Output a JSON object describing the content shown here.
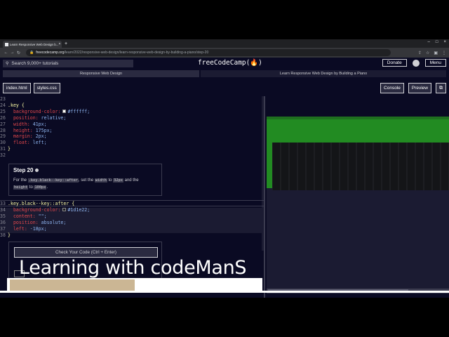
{
  "browser": {
    "tab_title": "Learn Responsive Web Design b...",
    "new_tab": "+",
    "url_host": "freecodecamp.org",
    "url_path": "/learn/2022/responsive-web-design/learn-responsive-web-design-by-building-a-piano/step-20"
  },
  "nav": {
    "search_placeholder": "Search 9,000+ tutorials",
    "brand": "freeCodeCamp(🔥)",
    "donate": "Donate",
    "menu": "Menu"
  },
  "breadcrumb": {
    "course": "Responsive Web Design",
    "project": "Learn Responsive Web Design by Building a Piano"
  },
  "editor": {
    "tabs": [
      "index.html",
      "styles.css"
    ],
    "console": "Console",
    "preview": "Preview"
  },
  "code_top": [
    {
      "n": "23"
    },
    {
      "n": "24",
      "sel": ".key {"
    },
    {
      "n": "25",
      "prop": "  background-color:",
      "swatch": "#ffffff",
      "val": "#ffffff;"
    },
    {
      "n": "26",
      "prop": "  position:",
      "val": " relative;"
    },
    {
      "n": "27",
      "prop": "  width:",
      "val": " 41px;"
    },
    {
      "n": "28",
      "prop": "  height:",
      "val": " 175px;"
    },
    {
      "n": "29",
      "prop": "  margin:",
      "val": " 2px;"
    },
    {
      "n": "30",
      "prop": "  float:",
      "val": " left;"
    },
    {
      "n": "31",
      "sel": "}"
    },
    {
      "n": "32"
    }
  ],
  "step": {
    "title": "Step 20",
    "t1": "For the ",
    "c1": ".key.black--key::after",
    "t2": ", set the ",
    "c2": "width",
    "t3": " to ",
    "c3": "32px",
    "t4": " and the",
    "c4": "height",
    "t5": " to ",
    "c5": "100px",
    "t6": "."
  },
  "code_bottom": [
    {
      "n": "33",
      "sel": ".key.black--key::after {"
    },
    {
      "n": "34",
      "prop": "  background-color:",
      "swatch": "#1d1e22",
      "val": "#1d1e22;"
    },
    {
      "n": "35",
      "prop": "  content:",
      "val": " \"\";"
    },
    {
      "n": "36",
      "prop": "  position:",
      "val": " absolute;"
    },
    {
      "n": "37",
      "prop": "  left:",
      "val": " -18px;"
    },
    {
      "n": "38",
      "sel": "}"
    }
  ],
  "check_button": "Check Your Code (Ctrl + Enter)",
  "overlay_caption": "Learning with codeManS",
  "video_progress": 0.49,
  "colors": {
    "piano_green": "#228b22",
    "key_black": "#1d1e22",
    "bg": "#0a0a23"
  }
}
